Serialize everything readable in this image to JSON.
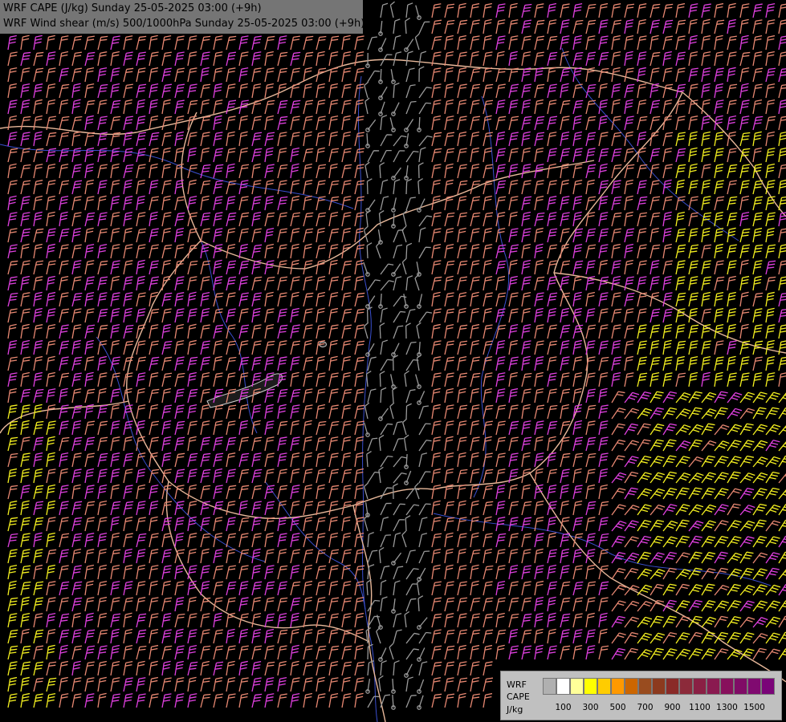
{
  "title": {
    "line1": "WRF CAPE (J/kg) Sunday 25-05-2025 03:00 (+9h)",
    "line2": "WRF Wind shear (m/s) 500/1000hPa Sunday 25-05-2025 03:00 (+9h)"
  },
  "legend": {
    "label_lines": [
      "WRF",
      "CAPE",
      "J/kg"
    ],
    "ticks": [
      "100",
      "300",
      "500",
      "700",
      "900",
      "1100",
      "1300",
      "1500"
    ],
    "colors": [
      "#b0b0b0",
      "#ffffff",
      "#ffff99",
      "#ffff00",
      "#ffcc00",
      "#ff9900",
      "#cc6600",
      "#994c1f",
      "#8c3a1e",
      "#8a2a28",
      "#8c2a3a",
      "#8a2044",
      "#8a1a50",
      "#88105c",
      "#800c66",
      "#800a70",
      "#7a0478"
    ]
  },
  "map_style": {
    "barb_colors": {
      "calm": "#9a9a9a",
      "moderate": "#e88872",
      "strong": "#e040e0",
      "very_strong": "#f4f020"
    },
    "border_color": "#e8b89a",
    "river_color": "#3a4fd0",
    "lake_color": "#cfcfcf"
  }
}
